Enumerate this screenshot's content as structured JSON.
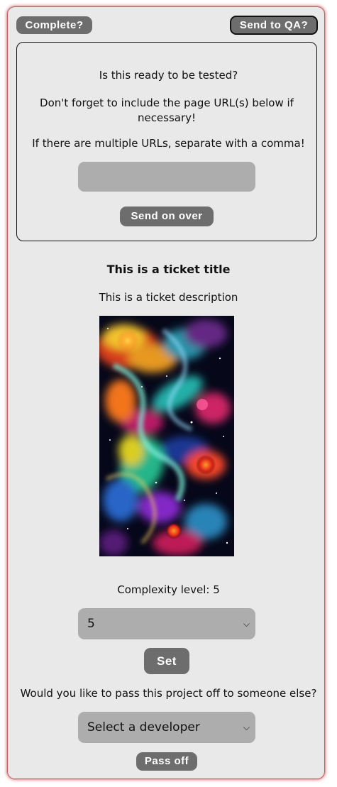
{
  "header": {
    "complete_label": "Complete?",
    "qa_label": "Send to QA?"
  },
  "qa_panel": {
    "question": "Is this ready to be tested?",
    "reminder": "Don't forget to include the page URL(s) below if necessary!",
    "multi_url_note": "If there are multiple URLs, separate with a comma!",
    "url_value": "",
    "send_label": "Send on over"
  },
  "ticket": {
    "title": "This is a ticket title",
    "description": "This is a ticket description",
    "image_icon": "cosmic-nebula-image"
  },
  "complexity": {
    "label": "Complexity level: 5",
    "selected": "5",
    "set_label": "Set"
  },
  "handoff": {
    "question": "Would you like to pass this project off to someone else?",
    "selected": "Select a developer",
    "pass_label": "Pass off"
  },
  "colors": {
    "card_bg": "#e9e9e9",
    "button_bg": "#6d6d6d",
    "field_bg": "#adadad",
    "card_glow": "#be1e28"
  }
}
